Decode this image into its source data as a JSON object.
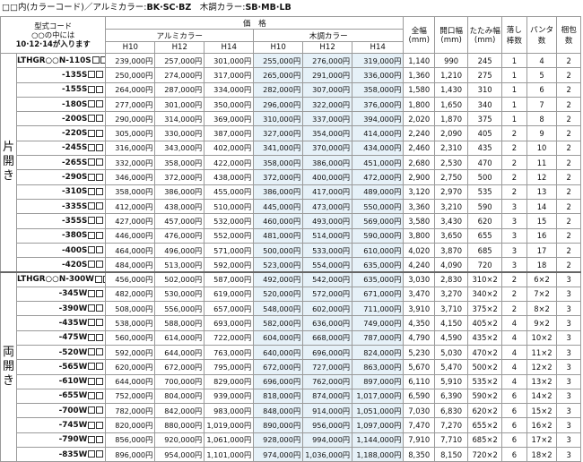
{
  "note": {
    "prefix": "□□内(カラーコード)／アルミカラー:",
    "alumi_codes": "BK·SC·BZ",
    "mid": "　木調カラー:",
    "wood_codes": "SB·MB·LB"
  },
  "header": {
    "type_code_line1": "型式コード",
    "type_code_line2": "○○の中には",
    "type_code_line3": "10·12·14が入ります",
    "price": "価　格",
    "alumi": "アルミカラー",
    "wood": "木調カラー",
    "h": [
      "H10",
      "H12",
      "H14",
      "H10",
      "H12",
      "H14"
    ],
    "width": "全幅(mm)",
    "opening": "開口幅(mm)",
    "tatami": "たたみ幅(mm)",
    "otoshi": "落し棒数",
    "panta": "パンタ数",
    "konpo": "梱包数"
  },
  "groups": [
    {
      "label": "片開き",
      "rows": [
        {
          "model": "LTHGR○○N-110S",
          "prices": [
            "239,000円",
            "257,000円",
            "301,000円",
            "255,000円",
            "276,000円",
            "319,000円"
          ],
          "width": "1,140",
          "open": "990",
          "tatami": "245",
          "otoshi": "1",
          "panta": "4",
          "konpo": "2"
        },
        {
          "model": "-135S",
          "prices": [
            "250,000円",
            "274,000円",
            "317,000円",
            "265,000円",
            "291,000円",
            "336,000円"
          ],
          "width": "1,360",
          "open": "1,210",
          "tatami": "275",
          "otoshi": "1",
          "panta": "5",
          "konpo": "2"
        },
        {
          "model": "-155S",
          "prices": [
            "264,000円",
            "287,000円",
            "334,000円",
            "282,000円",
            "307,000円",
            "358,000円"
          ],
          "width": "1,580",
          "open": "1,430",
          "tatami": "310",
          "otoshi": "1",
          "panta": "6",
          "konpo": "2"
        },
        {
          "model": "-180S",
          "prices": [
            "277,000円",
            "301,000円",
            "350,000円",
            "296,000円",
            "322,000円",
            "376,000円"
          ],
          "width": "1,800",
          "open": "1,650",
          "tatami": "340",
          "otoshi": "1",
          "panta": "7",
          "konpo": "2"
        },
        {
          "model": "-200S",
          "prices": [
            "290,000円",
            "314,000円",
            "369,000円",
            "310,000円",
            "337,000円",
            "394,000円"
          ],
          "width": "2,020",
          "open": "1,870",
          "tatami": "375",
          "otoshi": "1",
          "panta": "8",
          "konpo": "2"
        },
        {
          "model": "-220S",
          "prices": [
            "305,000円",
            "330,000円",
            "387,000円",
            "327,000円",
            "354,000円",
            "414,000円"
          ],
          "width": "2,240",
          "open": "2,090",
          "tatami": "405",
          "otoshi": "2",
          "panta": "9",
          "konpo": "2"
        },
        {
          "model": "-245S",
          "prices": [
            "316,000円",
            "343,000円",
            "402,000円",
            "341,000円",
            "370,000円",
            "434,000円"
          ],
          "width": "2,460",
          "open": "2,310",
          "tatami": "435",
          "otoshi": "2",
          "panta": "10",
          "konpo": "2"
        },
        {
          "model": "-265S",
          "prices": [
            "332,000円",
            "358,000円",
            "422,000円",
            "358,000円",
            "386,000円",
            "451,000円"
          ],
          "width": "2,680",
          "open": "2,530",
          "tatami": "470",
          "otoshi": "2",
          "panta": "11",
          "konpo": "2"
        },
        {
          "model": "-290S",
          "prices": [
            "346,000円",
            "372,000円",
            "438,000円",
            "372,000円",
            "400,000円",
            "472,000円"
          ],
          "width": "2,900",
          "open": "2,750",
          "tatami": "500",
          "otoshi": "2",
          "panta": "12",
          "konpo": "2"
        },
        {
          "model": "-310S",
          "prices": [
            "358,000円",
            "386,000円",
            "455,000円",
            "386,000円",
            "417,000円",
            "489,000円"
          ],
          "width": "3,120",
          "open": "2,970",
          "tatami": "535",
          "otoshi": "2",
          "panta": "13",
          "konpo": "2"
        },
        {
          "model": "-335S",
          "prices": [
            "412,000円",
            "438,000円",
            "510,000円",
            "445,000円",
            "473,000円",
            "550,000円"
          ],
          "width": "3,360",
          "open": "3,210",
          "tatami": "590",
          "otoshi": "3",
          "panta": "14",
          "konpo": "2"
        },
        {
          "model": "-355S",
          "prices": [
            "427,000円",
            "457,000円",
            "532,000円",
            "460,000円",
            "493,000円",
            "569,000円"
          ],
          "width": "3,580",
          "open": "3,430",
          "tatami": "620",
          "otoshi": "3",
          "panta": "15",
          "konpo": "2"
        },
        {
          "model": "-380S",
          "prices": [
            "446,000円",
            "476,000円",
            "552,000円",
            "481,000円",
            "514,000円",
            "590,000円"
          ],
          "width": "3,800",
          "open": "3,650",
          "tatami": "655",
          "otoshi": "3",
          "panta": "16",
          "konpo": "2"
        },
        {
          "model": "-400S",
          "prices": [
            "464,000円",
            "496,000円",
            "571,000円",
            "500,000円",
            "533,000円",
            "610,000円"
          ],
          "width": "4,020",
          "open": "3,870",
          "tatami": "685",
          "otoshi": "3",
          "panta": "17",
          "konpo": "2"
        },
        {
          "model": "-420S",
          "prices": [
            "484,000円",
            "513,000円",
            "592,000円",
            "523,000円",
            "554,000円",
            "635,000円"
          ],
          "width": "4,240",
          "open": "4,090",
          "tatami": "720",
          "otoshi": "3",
          "panta": "18",
          "konpo": "2"
        }
      ]
    },
    {
      "label": "両開き",
      "rows": [
        {
          "model": "LTHGR○○N-300W",
          "prices": [
            "456,000円",
            "502,000円",
            "587,000円",
            "492,000円",
            "542,000円",
            "635,000円"
          ],
          "width": "3,030",
          "open": "2,830",
          "tatami": "310×2",
          "otoshi": "2",
          "panta": "6×2",
          "konpo": "3"
        },
        {
          "model": "-345W",
          "prices": [
            "482,000円",
            "530,000円",
            "619,000円",
            "520,000円",
            "572,000円",
            "671,000円"
          ],
          "width": "3,470",
          "open": "3,270",
          "tatami": "340×2",
          "otoshi": "2",
          "panta": "7×2",
          "konpo": "3"
        },
        {
          "model": "-390W",
          "prices": [
            "508,000円",
            "556,000円",
            "657,000円",
            "548,000円",
            "602,000円",
            "711,000円"
          ],
          "width": "3,910",
          "open": "3,710",
          "tatami": "375×2",
          "otoshi": "2",
          "panta": "8×2",
          "konpo": "3"
        },
        {
          "model": "-435W",
          "prices": [
            "538,000円",
            "588,000円",
            "693,000円",
            "582,000円",
            "636,000円",
            "749,000円"
          ],
          "width": "4,350",
          "open": "4,150",
          "tatami": "405×2",
          "otoshi": "4",
          "panta": "9×2",
          "konpo": "3"
        },
        {
          "model": "-475W",
          "prices": [
            "560,000円",
            "614,000円",
            "722,000円",
            "604,000円",
            "668,000円",
            "787,000円"
          ],
          "width": "4,790",
          "open": "4,590",
          "tatami": "435×2",
          "otoshi": "4",
          "panta": "10×2",
          "konpo": "3"
        },
        {
          "model": "-520W",
          "prices": [
            "592,000円",
            "644,000円",
            "763,000円",
            "640,000円",
            "696,000円",
            "824,000円"
          ],
          "width": "5,230",
          "open": "5,030",
          "tatami": "470×2",
          "otoshi": "4",
          "panta": "11×2",
          "konpo": "3"
        },
        {
          "model": "-565W",
          "prices": [
            "620,000円",
            "672,000円",
            "795,000円",
            "672,000円",
            "727,000円",
            "863,000円"
          ],
          "width": "5,670",
          "open": "5,470",
          "tatami": "500×2",
          "otoshi": "4",
          "panta": "12×2",
          "konpo": "3"
        },
        {
          "model": "-610W",
          "prices": [
            "644,000円",
            "700,000円",
            "829,000円",
            "696,000円",
            "762,000円",
            "897,000円"
          ],
          "width": "6,110",
          "open": "5,910",
          "tatami": "535×2",
          "otoshi": "4",
          "panta": "13×2",
          "konpo": "3"
        },
        {
          "model": "-655W",
          "prices": [
            "752,000円",
            "804,000円",
            "939,000円",
            "818,000円",
            "874,000円",
            "1,017,000円"
          ],
          "width": "6,590",
          "open": "6,390",
          "tatami": "590×2",
          "otoshi": "6",
          "panta": "14×2",
          "konpo": "3"
        },
        {
          "model": "-700W",
          "prices": [
            "782,000円",
            "842,000円",
            "983,000円",
            "848,000円",
            "914,000円",
            "1,051,000円"
          ],
          "width": "7,030",
          "open": "6,830",
          "tatami": "620×2",
          "otoshi": "6",
          "panta": "15×2",
          "konpo": "3"
        },
        {
          "model": "-745W",
          "prices": [
            "820,000円",
            "880,000円",
            "1,019,000円",
            "890,000円",
            "956,000円",
            "1,097,000円"
          ],
          "width": "7,470",
          "open": "7,270",
          "tatami": "655×2",
          "otoshi": "6",
          "panta": "16×2",
          "konpo": "3"
        },
        {
          "model": "-790W",
          "prices": [
            "856,000円",
            "920,000円",
            "1,061,000円",
            "928,000円",
            "994,000円",
            "1,144,000円"
          ],
          "width": "7,910",
          "open": "7,710",
          "tatami": "685×2",
          "otoshi": "6",
          "panta": "17×2",
          "konpo": "3"
        },
        {
          "model": "-835W",
          "prices": [
            "896,000円",
            "954,000円",
            "1,101,000円",
            "974,000円",
            "1,036,000円",
            "1,188,000円"
          ],
          "width": "8,350",
          "open": "8,150",
          "tatami": "720×2",
          "otoshi": "6",
          "panta": "18×2",
          "konpo": "3"
        }
      ]
    }
  ]
}
